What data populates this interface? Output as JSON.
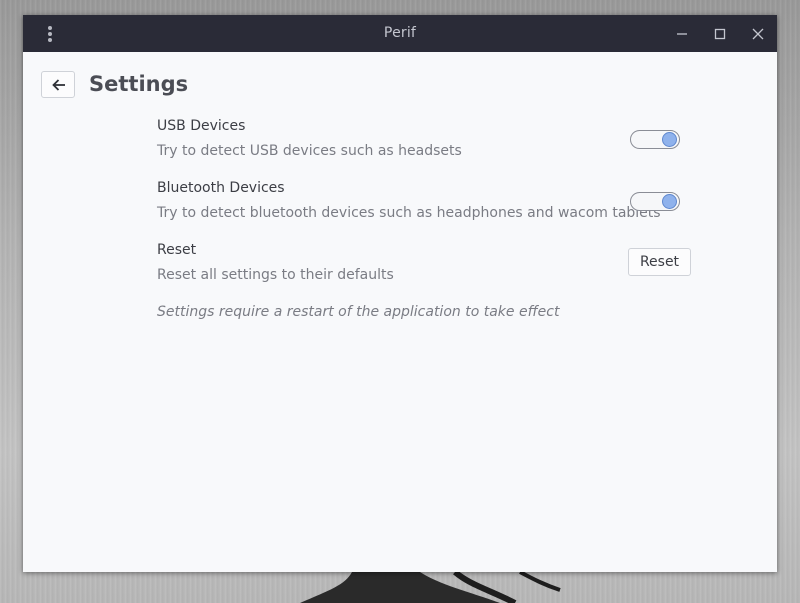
{
  "window": {
    "title": "Perif",
    "controls": {
      "menu": "vertical-dots-icon",
      "minimize": "minimize-icon",
      "maximize": "maximize-icon",
      "close": "close-icon"
    }
  },
  "header": {
    "back_icon": "arrow-left-icon",
    "title": "Settings"
  },
  "settings": [
    {
      "title": "USB Devices",
      "description": "Try to detect USB devices such as headsets",
      "control": "switch",
      "enabled": true
    },
    {
      "title": "Bluetooth Devices",
      "description": "Try to detect bluetooth devices such as headphones and wacom tablets",
      "control": "switch",
      "enabled": true
    },
    {
      "title": "Reset",
      "description": "Reset all settings to their defaults",
      "control": "button",
      "button_label": "Reset"
    }
  ],
  "note": "Settings require a restart of the application to take effect",
  "colors": {
    "titlebar": "#2a2b37",
    "content_bg": "#f8f9fb",
    "switch_knob": "#8fb2ec"
  }
}
